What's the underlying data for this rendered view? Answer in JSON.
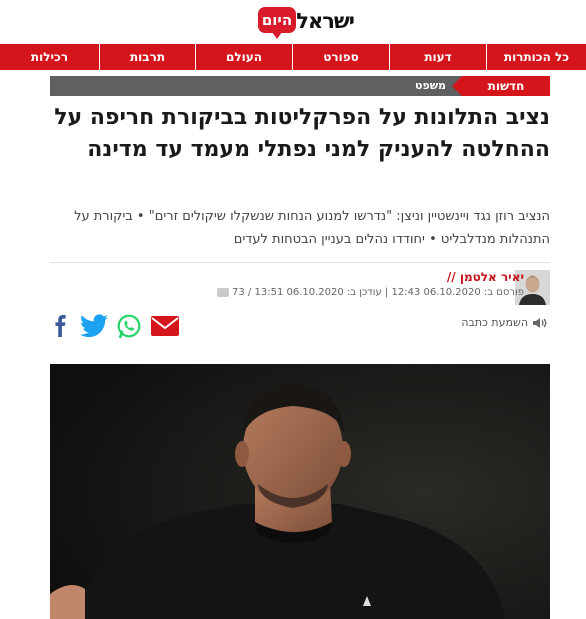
{
  "header": {
    "logo_main": "ישראל",
    "logo_badge": "היום"
  },
  "nav": {
    "items": [
      "כל הכותרות",
      "דעות",
      "ספורט",
      "העולם",
      "תרבות",
      "רכילות"
    ]
  },
  "breadcrumb": {
    "section": "חדשות",
    "subsection": "משפט"
  },
  "article": {
    "headline": "נציב התלונות על הפרקליטות בביקורת חריפה על ההחלטה להעניק למני נפתלי מעמד עד מדינה",
    "subtitle": "הנציב רוזן נגד ויינשטיין וניצן: \"נדרשו למנוע הנחות שנשקלו שיקולים זרים\" • ביקורת על התנהלות מנדלבליט • יחודדו נהלים בעניין הבטחות לעדים",
    "author": "יאיר אלטמן //",
    "meta_text": "פורסם ב: 06.10.2020 12:43 | עודכן ב: 06.10.2020 13:51 / 73",
    "listen_label": "השמעת כתבה"
  },
  "icons": {
    "email": "email-icon",
    "whatsapp": "whatsapp-icon",
    "twitter": "twitter-icon",
    "facebook": "facebook-icon",
    "speaker": "speaker-icon",
    "comment": "comment-icon"
  },
  "colors": {
    "brand_red": "#d4161c",
    "crumb_gray": "#5f6061",
    "facebook": "#3b5998",
    "twitter": "#1da1f2",
    "whatsapp": "#25d366",
    "email": "#d4161c"
  }
}
